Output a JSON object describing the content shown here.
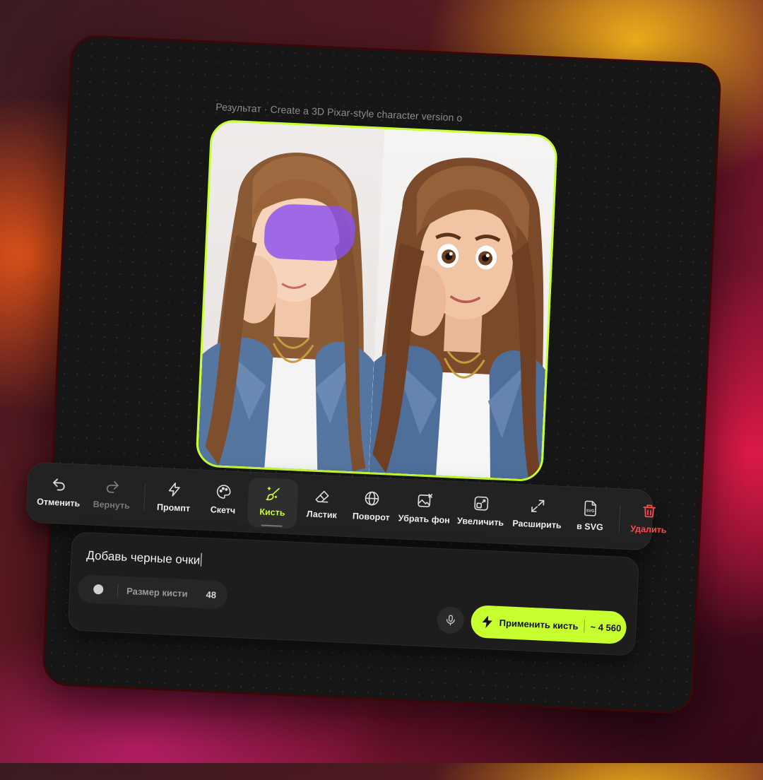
{
  "caption": "Результат · Create a 3D Pixar-style character version o",
  "colors": {
    "accent": "#c8ff2e",
    "danger": "#ff4a4a",
    "brush_mask": "#8b52ee"
  },
  "toolbar": {
    "items": [
      {
        "label": "Отменить",
        "icon": "undo-icon"
      },
      {
        "label": "Вернуть",
        "icon": "redo-icon"
      },
      {
        "label": "Промпт",
        "icon": "lightning-icon"
      },
      {
        "label": "Скетч",
        "icon": "palette-icon"
      },
      {
        "label": "Кисть",
        "icon": "magic-brush-icon",
        "active": true
      },
      {
        "label": "Ластик",
        "icon": "eraser-icon"
      },
      {
        "label": "Поворот",
        "icon": "rotate-globe-icon"
      },
      {
        "label": "Убрать фон",
        "icon": "remove-background-icon"
      },
      {
        "label": "Увеличить",
        "icon": "upscale-icon"
      },
      {
        "label": "Расширить",
        "icon": "expand-icon"
      },
      {
        "label": "в SVG",
        "icon": "svg-file-icon",
        "badge": "SVG"
      },
      {
        "label": "Удалить",
        "icon": "trash-icon"
      }
    ]
  },
  "prompt": {
    "text": "Добавь черные очки",
    "brush_size_label": "Размер кисти",
    "brush_size_value": "48",
    "apply_label": "Применить кисть",
    "apply_cost": "~ 4 560"
  }
}
